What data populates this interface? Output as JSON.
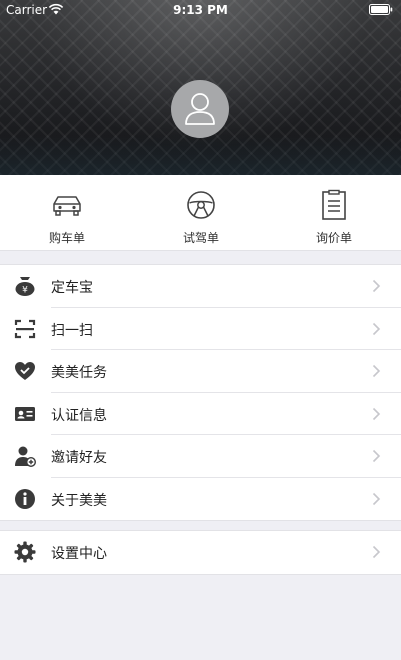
{
  "status_bar": {
    "carrier": "Carrier",
    "time": "9:13 PM"
  },
  "profile": {
    "avatar_icon": "user-placeholder-icon"
  },
  "quick_actions": [
    {
      "label": "购车单",
      "icon": "car-icon"
    },
    {
      "label": "试驾单",
      "icon": "steering-wheel-icon"
    },
    {
      "label": "询价单",
      "icon": "clipboard-icon"
    }
  ],
  "menu": [
    {
      "label": "定车宝",
      "icon": "money-bag-icon"
    },
    {
      "label": "扫一扫",
      "icon": "scan-icon"
    },
    {
      "label": "美美任务",
      "icon": "heart-icon"
    },
    {
      "label": "认证信息",
      "icon": "id-card-icon"
    },
    {
      "label": "邀请好友",
      "icon": "add-user-icon"
    },
    {
      "label": "关于美美",
      "icon": "info-icon"
    }
  ],
  "settings": {
    "label": "设置中心",
    "icon": "gear-icon"
  },
  "colors": {
    "icon": "#3a3a3a",
    "chevron": "#c7c7cc",
    "background": "#efeff4"
  }
}
